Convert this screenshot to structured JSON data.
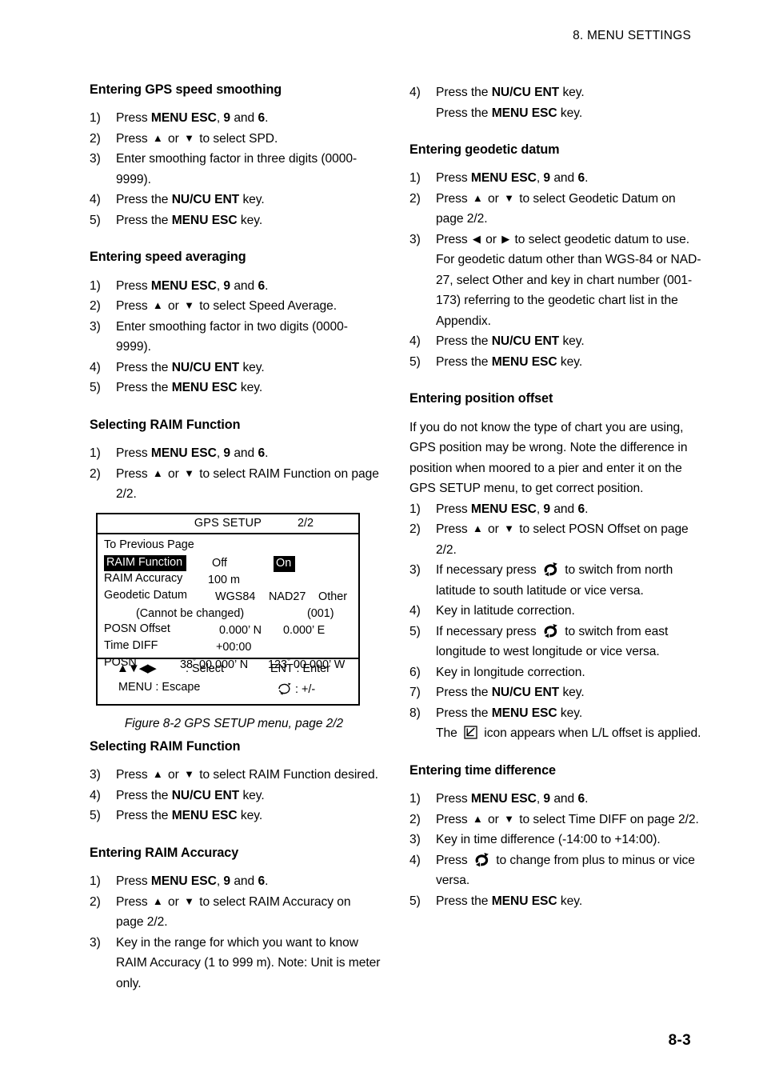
{
  "header": {
    "running_head": "8. MENU SETTINGS"
  },
  "footer": {
    "page_number": "8-3"
  },
  "left_column": {
    "sections": [
      {
        "id": "gps-speed-smoothing",
        "heading": "Entering GPS speed smoothing",
        "steps": [
          {
            "num": "1)",
            "parts": [
              {
                "t": "Press "
              },
              {
                "t": "MENU ESC",
                "b": true
              },
              {
                "t": ", "
              },
              {
                "t": "9",
                "b": true
              },
              {
                "t": " and "
              },
              {
                "t": "6",
                "b": true
              },
              {
                "t": "."
              }
            ]
          },
          {
            "num": "2)",
            "parts": [
              {
                "t": "Press "
              },
              {
                "icon": "up-triangle"
              },
              {
                "t": " or "
              },
              {
                "icon": "down-triangle"
              },
              {
                "t": " to select SPD."
              }
            ]
          },
          {
            "num": "3)",
            "parts": [
              {
                "t": "Enter smoothing factor in three digits (0000-9999)."
              }
            ]
          },
          {
            "num": "4)",
            "parts": [
              {
                "t": "Press the "
              },
              {
                "t": "NU/CU ENT",
                "b": true
              },
              {
                "t": " key."
              }
            ]
          },
          {
            "num": "5)",
            "parts": [
              {
                "t": "Press the "
              },
              {
                "t": "MENU ESC",
                "b": true
              },
              {
                "t": " key."
              }
            ]
          }
        ]
      },
      {
        "id": "speed-averaging",
        "heading": "Entering speed averaging",
        "steps": [
          {
            "num": "1)",
            "parts": [
              {
                "t": "Press "
              },
              {
                "t": "MENU ESC",
                "b": true
              },
              {
                "t": ", "
              },
              {
                "t": "9",
                "b": true
              },
              {
                "t": " and "
              },
              {
                "t": "6",
                "b": true
              },
              {
                "t": "."
              }
            ]
          },
          {
            "num": "2)",
            "parts": [
              {
                "t": "Press "
              },
              {
                "icon": "up-triangle"
              },
              {
                "t": " or "
              },
              {
                "icon": "down-triangle"
              },
              {
                "t": " to select Speed Average."
              }
            ]
          },
          {
            "num": "3)",
            "parts": [
              {
                "t": "Enter smoothing factor in two digits (0000-9999)."
              }
            ]
          },
          {
            "num": "4)",
            "parts": [
              {
                "t": "Press the "
              },
              {
                "t": "NU/CU ENT",
                "b": true
              },
              {
                "t": " key."
              }
            ]
          },
          {
            "num": "5)",
            "parts": [
              {
                "t": "Press the "
              },
              {
                "t": "MENU ESC",
                "b": true
              },
              {
                "t": " key."
              }
            ]
          }
        ]
      },
      {
        "id": "selecting-raim-function",
        "heading": "Selecting RAIM Function",
        "steps": [
          {
            "num": "1)",
            "parts": [
              {
                "t": "Press "
              },
              {
                "t": "MENU ESC",
                "b": true
              },
              {
                "t": ", "
              },
              {
                "t": "9",
                "b": true
              },
              {
                "t": " and "
              },
              {
                "t": "6",
                "b": true
              },
              {
                "t": "."
              }
            ]
          },
          {
            "num": "2)",
            "parts": [
              {
                "t": "Press "
              },
              {
                "icon": "up-triangle"
              },
              {
                "t": " or "
              },
              {
                "icon": "down-triangle"
              },
              {
                "t": " to select RAIM Function on page 2/2."
              }
            ]
          }
        ],
        "steps_after_figure": [
          {
            "num": "3)",
            "parts": [
              {
                "t": "Press "
              },
              {
                "icon": "up-triangle"
              },
              {
                "t": " or "
              },
              {
                "icon": "down-triangle"
              },
              {
                "t": " to select RAIM Function desired."
              }
            ]
          },
          {
            "num": "4)",
            "parts": [
              {
                "t": "Press the "
              },
              {
                "t": "NU/CU ENT",
                "b": true
              },
              {
                "t": " key."
              }
            ]
          },
          {
            "num": "5)",
            "parts": [
              {
                "t": "Press the "
              },
              {
                "t": "MENU ESC",
                "b": true
              },
              {
                "t": " key."
              }
            ]
          }
        ]
      },
      {
        "id": "entering-raim-accuracy",
        "heading": "Entering RAIM Accuracy",
        "steps": [
          {
            "num": "1)",
            "parts": [
              {
                "t": "Press "
              },
              {
                "t": "MENU ESC",
                "b": true
              },
              {
                "t": ", "
              },
              {
                "t": "9",
                "b": true
              },
              {
                "t": " and "
              },
              {
                "t": "6",
                "b": true
              },
              {
                "t": "."
              }
            ]
          },
          {
            "num": "2)",
            "parts": [
              {
                "t": "Press "
              },
              {
                "icon": "up-triangle"
              },
              {
                "t": " or "
              },
              {
                "icon": "down-triangle"
              },
              {
                "t": " to select RAIM Accuracy on page 2/2."
              }
            ]
          },
          {
            "num": "3)",
            "parts": [
              {
                "t": "Key in the range for which you want to know RAIM Accuracy (1 to 999 m). Note: Unit is meter only."
              }
            ]
          }
        ]
      }
    ]
  },
  "figure": {
    "caption": "Figure 8-2 GPS SETUP menu, page 2/2",
    "screen": {
      "title": "GPS SETUP",
      "page_indicator": "2/2",
      "rows": {
        "to_previous_page": "To Previous Page",
        "raim_function_label": "RAIM Function",
        "raim_function_off": "Off",
        "raim_function_on": "On",
        "raim_accuracy_label": "RAIM Accuracy",
        "raim_accuracy_value": "100 m",
        "geodetic_datum_label": "Geodetic Datum",
        "geodetic_datum_wgs84": "WGS84",
        "geodetic_datum_nad27": "NAD27",
        "geodetic_datum_other": "Other",
        "cannot_be_changed": "(Cannot be changed)",
        "other_number": "(001)",
        "posn_offset_label": "POSN Offset",
        "posn_offset_lat": "0.000’ N",
        "posn_offset_lon": "0.000’ E",
        "time_diff_label": "Time DIFF",
        "time_diff_value": "+00:00",
        "posn_label": "POSN",
        "posn_lat": "38° 00.000’ N",
        "posn_lon": "123° 00.000’ W"
      },
      "footer": {
        "select_label": ": Select",
        "enter_label": "ENT : Enter",
        "escape_label": "MENU : Escape",
        "plusminus_label": ": +/-"
      }
    }
  },
  "right_column": {
    "sections": [
      {
        "id": "raim-accuracy-continued",
        "heading": null,
        "steps": [
          {
            "num": "4)",
            "parts": [
              {
                "t": "Press the "
              },
              {
                "t": "NU/CU ENT",
                "b": true
              },
              {
                "t": " key."
              }
            ],
            "extra_line": [
              {
                "t": "Press the "
              },
              {
                "t": "MENU ESC",
                "b": true
              },
              {
                "t": " key."
              }
            ]
          }
        ]
      },
      {
        "id": "entering-geodetic-datum",
        "heading": "Entering geodetic datum",
        "steps": [
          {
            "num": "1)",
            "parts": [
              {
                "t": "Press "
              },
              {
                "t": "MENU ESC",
                "b": true
              },
              {
                "t": ", "
              },
              {
                "t": "9",
                "b": true
              },
              {
                "t": " and "
              },
              {
                "t": "6",
                "b": true
              },
              {
                "t": "."
              }
            ]
          },
          {
            "num": "2)",
            "parts": [
              {
                "t": "Press "
              },
              {
                "icon": "up-triangle"
              },
              {
                "t": " or "
              },
              {
                "icon": "down-triangle"
              },
              {
                "t": " to select Geodetic Datum on page 2/2."
              }
            ]
          },
          {
            "num": "3)",
            "parts": [
              {
                "t": "Press "
              },
              {
                "icon": "left-triangle"
              },
              {
                "t": " or "
              },
              {
                "icon": "right-triangle"
              },
              {
                "t": " to select geodetic datum to use. For geodetic datum other than WGS-84 or NAD-27, select Other and key in chart number (001-173) referring to the geodetic chart list in the Appendix."
              }
            ]
          },
          {
            "num": "4)",
            "parts": [
              {
                "t": "Press the "
              },
              {
                "t": "NU/CU ENT",
                "b": true
              },
              {
                "t": " key."
              }
            ]
          },
          {
            "num": "5)",
            "parts": [
              {
                "t": "Press the "
              },
              {
                "t": "MENU ESC",
                "b": true
              },
              {
                "t": " key."
              }
            ]
          }
        ]
      },
      {
        "id": "entering-position-offset",
        "heading": "Entering position offset",
        "intro": "If you do not know the type of chart you are using, GPS position may be wrong. Note the difference in position when moored to a pier and enter it on the GPS SETUP menu, to get correct position.",
        "steps": [
          {
            "num": "1)",
            "parts": [
              {
                "t": "Press "
              },
              {
                "t": "MENU ESC",
                "b": true
              },
              {
                "t": ", "
              },
              {
                "t": "9",
                "b": true
              },
              {
                "t": " and "
              },
              {
                "t": "6",
                "b": true
              },
              {
                "t": "."
              }
            ]
          },
          {
            "num": "2)",
            "parts": [
              {
                "t": "Press "
              },
              {
                "icon": "up-triangle"
              },
              {
                "t": " or "
              },
              {
                "icon": "down-triangle"
              },
              {
                "t": " to select POSN Offset on page 2/2."
              }
            ]
          },
          {
            "num": "3)",
            "parts": [
              {
                "t": "If necessary press "
              },
              {
                "icon": "cycle"
              },
              {
                "t": " to switch from north latitude to south latitude or vice versa."
              }
            ]
          },
          {
            "num": "4)",
            "parts": [
              {
                "t": "Key in latitude correction."
              }
            ]
          },
          {
            "num": "5)",
            "parts": [
              {
                "t": "If necessary press "
              },
              {
                "icon": "cycle"
              },
              {
                "t": " to switch from east longitude to west longitude or vice versa."
              }
            ]
          },
          {
            "num": "6)",
            "parts": [
              {
                "t": "Key in longitude correction."
              }
            ]
          },
          {
            "num": "7)",
            "parts": [
              {
                "t": "Press the "
              },
              {
                "t": "NU/CU ENT",
                "b": true
              },
              {
                "t": " key."
              }
            ]
          },
          {
            "num": "8)",
            "parts": [
              {
                "t": "Press the "
              },
              {
                "t": "MENU ESC",
                "b": true
              },
              {
                "t": " key."
              }
            ],
            "extra_line": [
              {
                "t": "The "
              },
              {
                "icon": "ll-offset"
              },
              {
                "t": " icon appears when L/L offset is applied."
              }
            ]
          }
        ]
      },
      {
        "id": "entering-time-difference",
        "heading": "Entering time difference",
        "steps": [
          {
            "num": "1)",
            "parts": [
              {
                "t": "Press "
              },
              {
                "t": "MENU ESC",
                "b": true
              },
              {
                "t": ", "
              },
              {
                "t": "9",
                "b": true
              },
              {
                "t": " and "
              },
              {
                "t": "6",
                "b": true
              },
              {
                "t": "."
              }
            ]
          },
          {
            "num": "2)",
            "parts": [
              {
                "t": "Press "
              },
              {
                "icon": "up-triangle"
              },
              {
                "t": " or "
              },
              {
                "icon": "down-triangle"
              },
              {
                "t": " to select Time DIFF on page 2/2."
              }
            ]
          },
          {
            "num": "3)",
            "parts": [
              {
                "t": "Key in time difference (-14:00 to +14:00)."
              }
            ]
          },
          {
            "num": "4)",
            "parts": [
              {
                "t": "Press "
              },
              {
                "icon": "cycle"
              },
              {
                "t": " to change from plus to minus or vice versa."
              }
            ]
          },
          {
            "num": "5)",
            "parts": [
              {
                "t": "Press the "
              },
              {
                "t": "MENU ESC",
                "b": true
              },
              {
                "t": " key."
              }
            ]
          }
        ]
      }
    ]
  },
  "icons": {
    "up-triangle": "▲",
    "down-triangle": "▼",
    "left-triangle": "◀",
    "right-triangle": "▶"
  }
}
